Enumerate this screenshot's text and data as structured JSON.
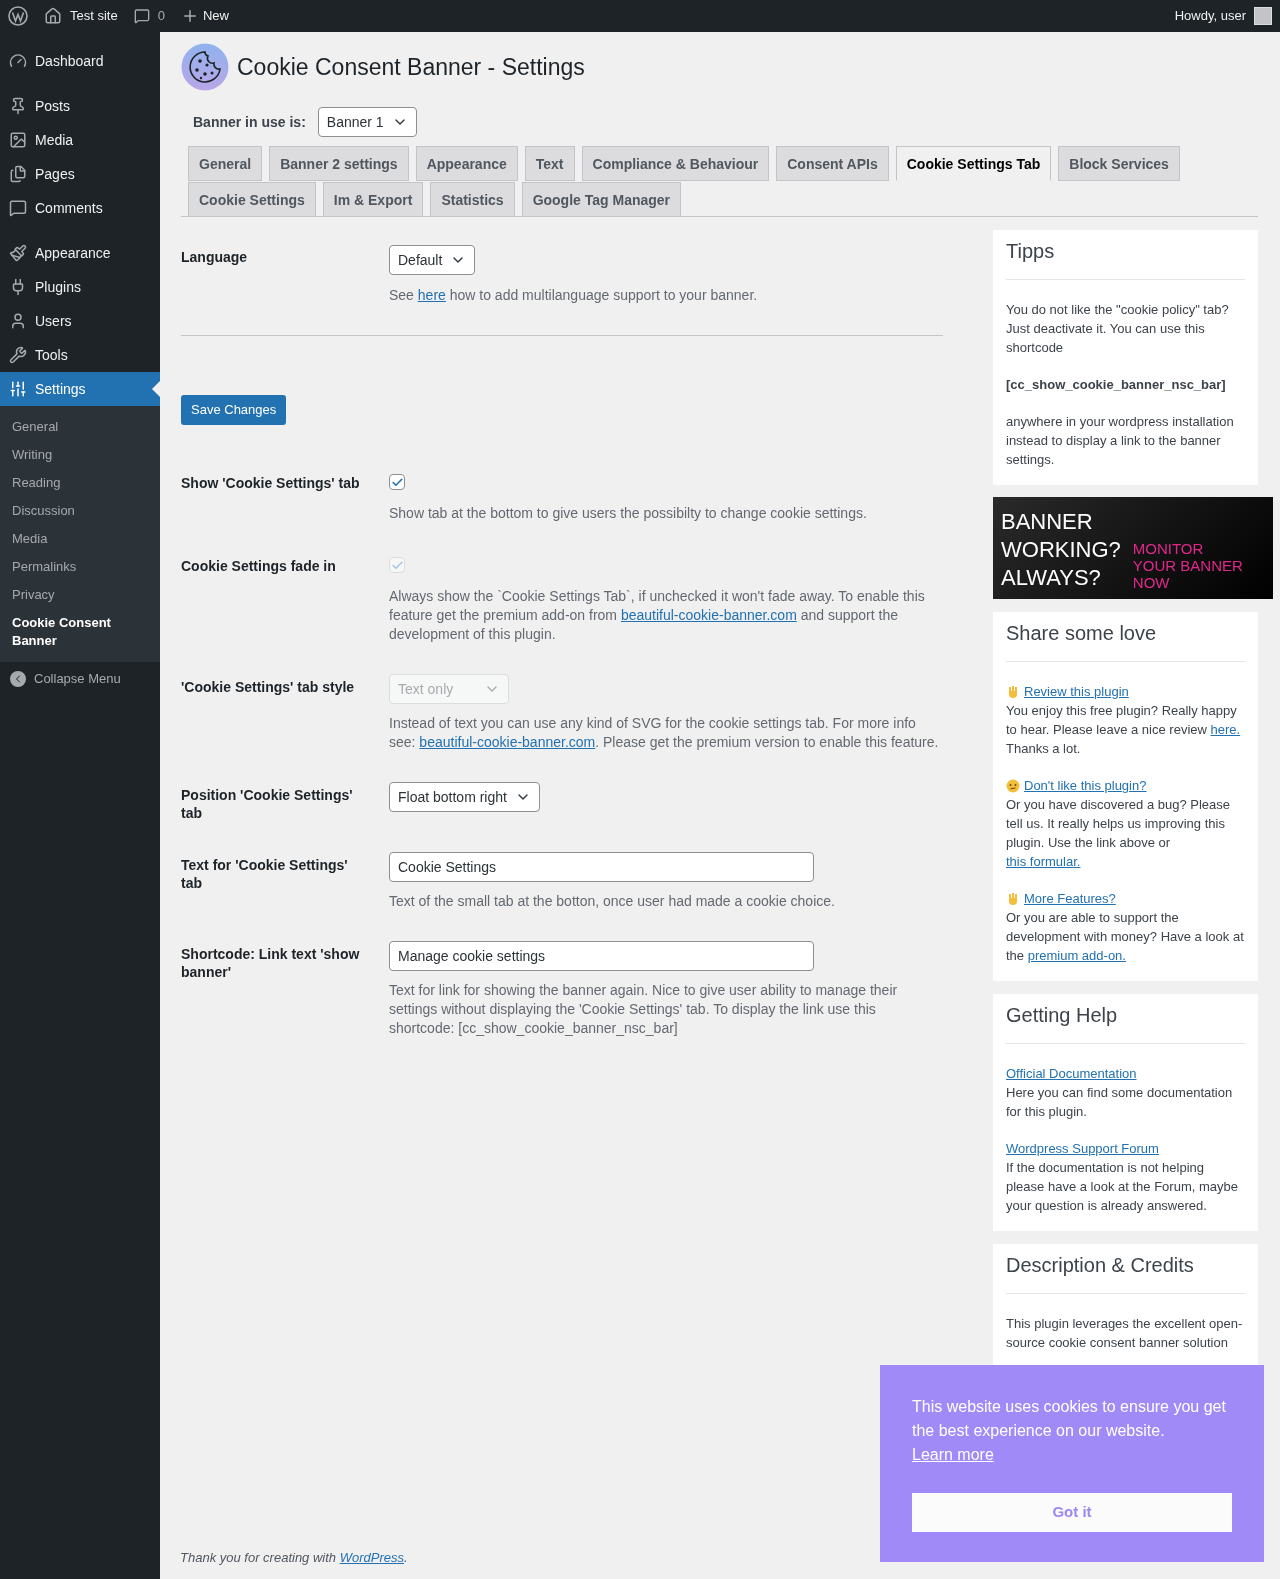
{
  "top_bar": {
    "site": "Test site",
    "comments": "0",
    "new": "New",
    "greeting": "Howdy, user"
  },
  "sidebar": {
    "items": [
      {
        "label": "Dashboard",
        "selected": false
      },
      {
        "label": "Posts",
        "selected": false
      },
      {
        "label": "Media",
        "selected": false
      },
      {
        "label": "Pages",
        "selected": false
      },
      {
        "label": "Comments",
        "selected": false
      },
      {
        "label": "Appearance",
        "selected": false
      },
      {
        "label": "Plugins",
        "selected": false
      },
      {
        "label": "Users",
        "selected": false
      },
      {
        "label": "Tools",
        "selected": false
      },
      {
        "label": "Settings",
        "selected": true
      }
    ],
    "submenu": [
      {
        "label": "General",
        "selected": false
      },
      {
        "label": "Writing",
        "selected": false
      },
      {
        "label": "Reading",
        "selected": false
      },
      {
        "label": "Discussion",
        "selected": false
      },
      {
        "label": "Media",
        "selected": false
      },
      {
        "label": "Permalinks",
        "selected": false
      },
      {
        "label": "Privacy",
        "selected": false
      },
      {
        "label": "Cookie Consent Banner",
        "selected": true
      }
    ],
    "collapse": "Collapse Menu"
  },
  "page": {
    "title": "Cookie Consent Banner - Settings",
    "banner_select": {
      "label": "Banner in use is:",
      "value": "Banner 1"
    },
    "tabs": [
      {
        "label": "General",
        "selected": false
      },
      {
        "label": "Banner 2 settings",
        "selected": false
      },
      {
        "label": "Appearance",
        "selected": false
      },
      {
        "label": "Text",
        "selected": false
      },
      {
        "label": "Compliance & Behaviour",
        "selected": false
      },
      {
        "label": "Consent APIs",
        "selected": false
      },
      {
        "label": "Cookie Settings Tab",
        "selected": true
      },
      {
        "label": "Block Services",
        "selected": false
      },
      {
        "label": "Cookie Settings",
        "selected": false
      },
      {
        "label": "Im & Export",
        "selected": false
      },
      {
        "label": "Statistics",
        "selected": false
      },
      {
        "label": "Google Tag Manager",
        "selected": false
      }
    ],
    "language": {
      "label": "Language",
      "value": "Default",
      "help": [
        {
          "kind": "text",
          "text": "See "
        },
        {
          "kind": "link",
          "text": "here"
        },
        {
          "kind": "text",
          "text": " how to add multilanguage support to your banner."
        }
      ]
    },
    "save_button": "Save Changes",
    "settings": [
      {
        "kind": "checkbox",
        "label": "Show 'Cookie Settings' tab",
        "checked": true,
        "disabled": false,
        "help": [
          {
            "kind": "text",
            "text": "Show tab at the bottom to give users the possibilty to change cookie settings."
          }
        ]
      },
      {
        "kind": "checkbox",
        "label": "Cookie Settings fade in",
        "checked": true,
        "disabled": true,
        "help": [
          {
            "kind": "text",
            "text": "Always show the `Cookie Settings Tab`, if unchecked it won't fade away. To enable this feature get the premium add-on from "
          },
          {
            "kind": "link",
            "text": "beautiful-cookie-banner.com"
          },
          {
            "kind": "text",
            "text": " and support the development of this plugin."
          }
        ]
      },
      {
        "kind": "select",
        "label": "'Cookie Settings' tab style",
        "value": "Text only",
        "disabled": true,
        "help": [
          {
            "kind": "text",
            "text": "Instead of text you can use any kind of SVG for the cookie settings tab. For more info see: "
          },
          {
            "kind": "link",
            "text": "beautiful-cookie-banner.com"
          },
          {
            "kind": "text",
            "text": ". Please get the premium version to enable this feature."
          }
        ]
      },
      {
        "kind": "select",
        "label": "Position 'Cookie Settings' tab",
        "value": "Float bottom right",
        "disabled": false
      },
      {
        "kind": "input",
        "label": "Text for 'Cookie Settings' tab",
        "value": "Cookie Settings",
        "disabled": false,
        "help": [
          {
            "kind": "text",
            "text": "Text of the small tab at the botton, once user had made a cookie choice."
          }
        ]
      },
      {
        "kind": "input",
        "label": "Shortcode: Link text 'show banner'",
        "value": "Manage cookie settings",
        "disabled": false,
        "help": [
          {
            "kind": "text",
            "text": "Text for link for showing the banner again. Nice to give user ability to manage their settings without displaying the 'Cookie Settings' tab. To display the link use this shortcode: [cc_show_cookie_banner_nsc_bar]"
          }
        ]
      }
    ]
  },
  "tipps": {
    "title": "Tipps",
    "paragraphs": [
      {
        "kind": "text",
        "text": "You do not like the \"cookie policy\" tab? Just deactivate it. You can use this shortcode"
      },
      {
        "kind": "code",
        "text": "[cc_show_cookie_banner_nsc_bar]"
      },
      {
        "kind": "text",
        "text": "anywhere in your wordpress installation instead to display a link to the banner settings."
      }
    ]
  },
  "ad": {
    "headline": [
      "BANNER",
      "WORKING?",
      "ALWAYS?"
    ],
    "cta": [
      "MONITOR",
      "YOUR BANNER",
      "NOW"
    ]
  },
  "share": {
    "title": "Share some love",
    "items": [
      {
        "link": "Review this plugin",
        "body": [
          {
            "kind": "text",
            "text": "You enjoy this free plugin? Really happy to hear. Please leave a nice review "
          },
          {
            "kind": "link",
            "text": "here."
          },
          {
            "kind": "text",
            "text": " Thanks a lot."
          }
        ]
      },
      {
        "link": "Don't like this plugin?",
        "body": [
          {
            "kind": "text",
            "text": "Or you have discovered a bug? Please tell us. It really helps us improving this plugin. Use the link above or "
          },
          {
            "kind": "link",
            "text": "this formular."
          }
        ]
      },
      {
        "link": "More Features?",
        "body": [
          {
            "kind": "text",
            "text": "Or you are able to support the development with money? Have a look at the "
          },
          {
            "kind": "link",
            "text": "premium add-on."
          }
        ]
      }
    ]
  },
  "help": {
    "title": "Getting Help",
    "items": [
      {
        "link": "Official Documentation",
        "body": "Here you can find some documentation for this plugin."
      },
      {
        "link": "Wordpress Support Forum",
        "body": "If the documentation is not helping please have a look at the Forum, maybe your question is already answered."
      }
    ]
  },
  "credits": {
    "title": "Description & Credits",
    "body": "This plugin leverages the excellent open-source cookie consent banner solution"
  },
  "footer": {
    "text": "Thank you for creating with ",
    "link": "WordPress",
    "end": "."
  },
  "cookie_popup": {
    "message": "This website uses cookies to ensure you get the best experience on our website.",
    "link": "Learn more",
    "button": "Got it"
  }
}
